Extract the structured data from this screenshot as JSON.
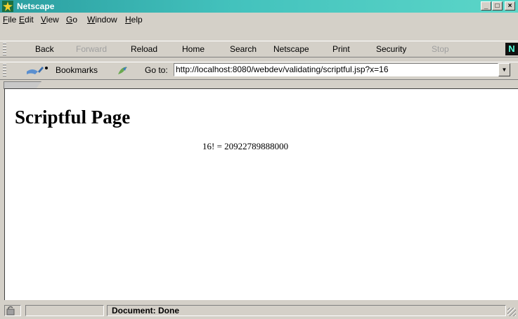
{
  "window": {
    "title": "Netscape",
    "minimize": "_",
    "maximize": "□",
    "close": "×"
  },
  "menu": {
    "items": [
      {
        "label": "File",
        "mnemonic": "F",
        "rest": "ile"
      },
      {
        "label": "Edit",
        "mnemonic": "E",
        "rest": "dit"
      },
      {
        "label": "View",
        "mnemonic": "V",
        "rest": "iew"
      },
      {
        "label": "Go",
        "mnemonic": "G",
        "rest": "o"
      },
      {
        "label": "Window",
        "mnemonic": "W",
        "rest": "indow"
      },
      {
        "label": "Help",
        "mnemonic": "H",
        "rest": "elp"
      }
    ]
  },
  "navigation": {
    "back": "Back",
    "forward": "Forward",
    "reload": "Reload",
    "home": "Home",
    "search": "Search",
    "netscape": "Netscape",
    "print": "Print",
    "security": "Security",
    "stop": "Stop",
    "logo": "N"
  },
  "location": {
    "bookmarks_label": "Bookmarks",
    "goto_label": "Go to:",
    "url": "http://localhost:8080/webdev/validating/scriptful.jsp?x=16",
    "dropdown": "▼"
  },
  "page": {
    "heading": "Scriptful Page",
    "result": "16! = 20922789888000"
  },
  "status": {
    "text": "Document: Done"
  }
}
